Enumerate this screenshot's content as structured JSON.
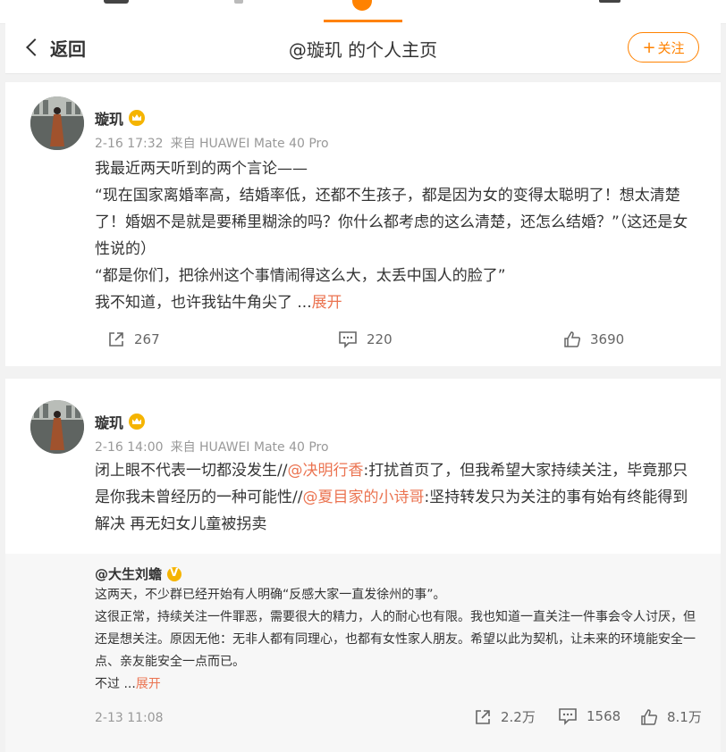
{
  "header": {
    "back_label": "返回",
    "title": "@璇玑 的个人主页",
    "follow_label": "关注",
    "follow_plus": "+"
  },
  "colors": {
    "accent": "#ff8200",
    "link": "#eb7350"
  },
  "posts": [
    {
      "author": "璇玑",
      "time": "2-16 17:32",
      "source": "来自 HUAWEI Mate 40 Pro",
      "lines": [
        "我最近两天听到的两个言论——",
        "“现在国家离婚率高，结婚率低，还都不生孩子，都是因为女的变得太聪明了！想太清楚了！婚姻不是就是要稀里糊涂的吗？你什么都考虑的这么清楚，还怎么结婚？”（这还是女性说的）",
        "“都是你们，把徐州这个事情闹得这么大，太丢中国人的脸了”"
      ],
      "last_line": "我不知道，也许我钻牛角尖了",
      "ellipsis": "...",
      "expand": "展开",
      "reposts": "267",
      "comments": "220",
      "likes": "3690"
    },
    {
      "author": "璇玑",
      "time": "2-16 14:00",
      "source": "来自 HUAWEI Mate 40 Pro",
      "seg1": "闭上眼不代表一切都没发生//",
      "mention1": "@决明行香",
      "seg2": ":打扰首页了，但我希望大家持续关注，毕竟那只是你我未曾经历的一种可能性//",
      "mention2": "@夏目家的小诗哥",
      "seg3": ":坚持转发只为关注的事有始有终能得到解决 再无妇女儿童被拐卖",
      "repost": {
        "author": "@大生刘蟾",
        "lines": [
          "这两天，不少群已经开始有人明确“反感大家一直发徐州的事”。",
          "这很正常，持续关注一件罪恶，需要很大的精力，人的耐心也有限。我也知道一直关注一件事会令人讨厌，但还是想关注。原因无他：无非人都有同理心，也都有女性家人朋友。希望以此为契机，让未来的环境能安全一点、亲友能安全一点而已。"
        ],
        "last_line": "不过",
        "ellipsis": "...",
        "expand": "展开",
        "time": "2-13 11:08",
        "reposts": "2.2万",
        "comments": "1568",
        "likes": "8.1万"
      }
    }
  ]
}
